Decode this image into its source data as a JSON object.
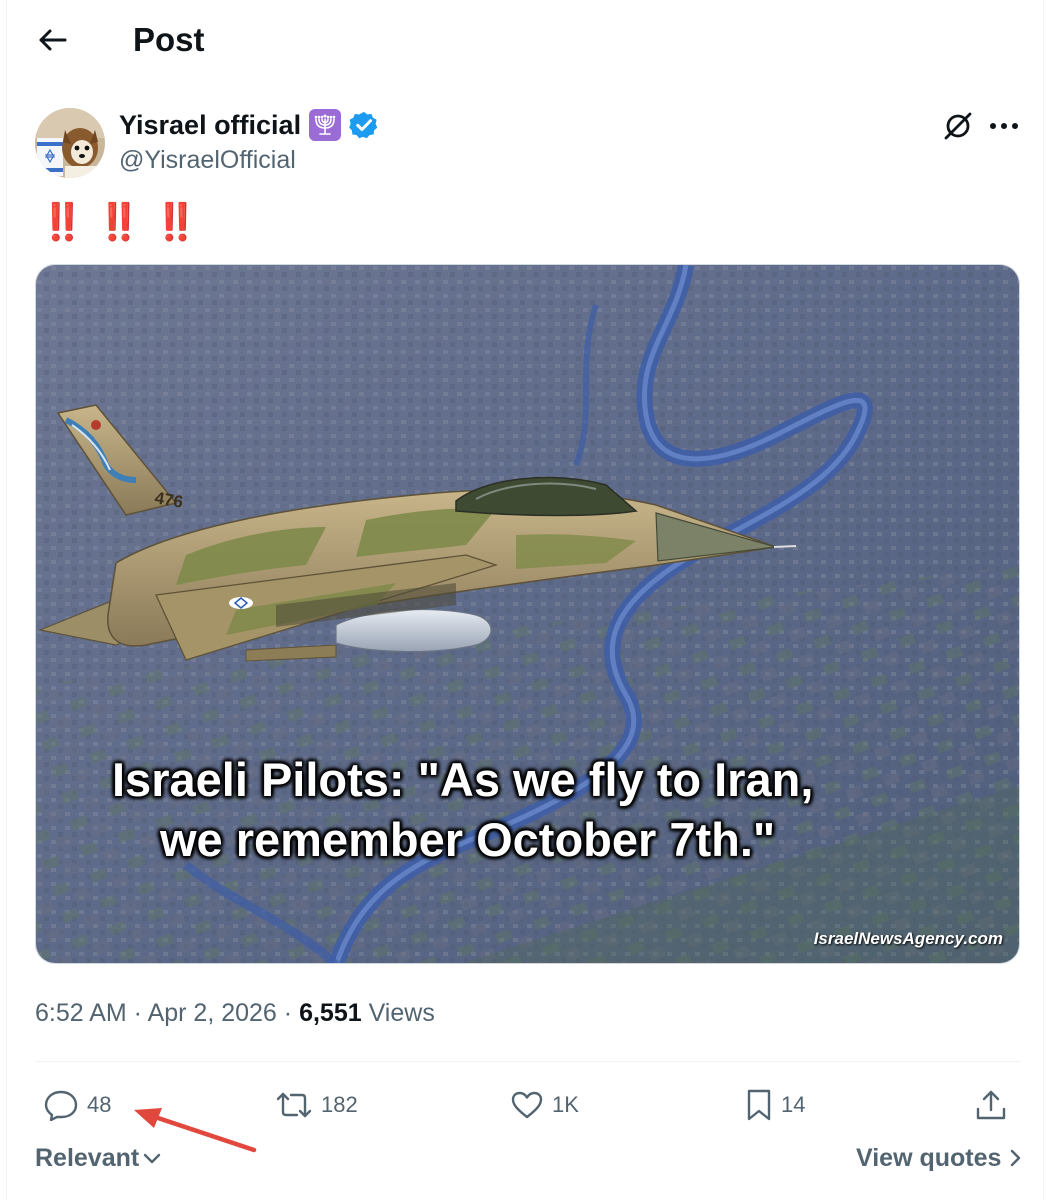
{
  "header": {
    "title": "Post",
    "back_icon": "arrow-left-icon"
  },
  "author": {
    "name": "Yisrael official",
    "handle": "@YisraelOfficial",
    "badge_emoji": "menorah-icon",
    "verified": true
  },
  "post": {
    "text": "‼️ ‼️ ‼️",
    "image_caption_line1": "Israeli Pilots: \"As we fly to Iran,",
    "image_caption_line2": "we remember October 7th.\"",
    "image_watermark": "IsraelNewsAgency.com",
    "aircraft_tail_number": "476"
  },
  "meta": {
    "time": "6:52 AM",
    "separator": " · ",
    "date": "Apr 2, 2026",
    "views_count": "6,551",
    "views_label": "Views"
  },
  "actions": {
    "reply_count": "48",
    "repost_count": "182",
    "like_count": "1K",
    "bookmark_count": "14"
  },
  "footer": {
    "sort_label": "Relevant",
    "view_quotes_label": "View quotes"
  },
  "colors": {
    "text_primary": "#0f1419",
    "text_secondary": "#536471",
    "verified_blue": "#1d9bf0",
    "annotation_red": "#e0483e",
    "emphasis_red": "#d4212f"
  }
}
